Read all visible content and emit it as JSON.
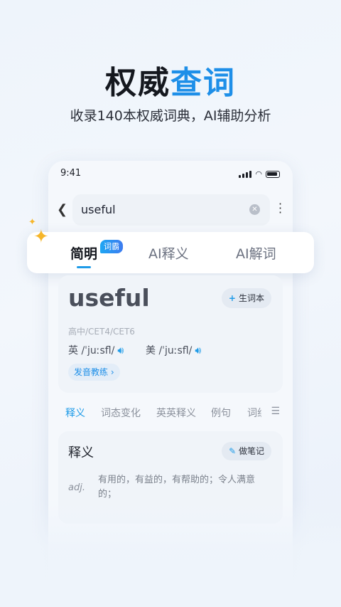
{
  "hero": {
    "title_part1": "权威",
    "title_part2": "查词",
    "subtitle": "收录140本权威词典，AI辅助分析"
  },
  "status_bar": {
    "time": "9:41"
  },
  "search": {
    "value": "useful"
  },
  "tabs": {
    "items": [
      {
        "label": "简明",
        "active": true
      },
      {
        "label": "AI释义",
        "active": false
      },
      {
        "label": "AI解词",
        "active": false
      }
    ],
    "badge": "词霸"
  },
  "word": {
    "text": "useful",
    "add_label": "生词本",
    "level": "高中/CET4/CET6",
    "uk": {
      "label": "英",
      "phonetic": "/ˈjuːsfl/"
    },
    "us": {
      "label": "美",
      "phonetic": "/ˈjuːsfl/"
    },
    "pron_button": "发音教练"
  },
  "subtabs": [
    "释义",
    "词态变化",
    "英英释义",
    "例句",
    "词组"
  ],
  "definition": {
    "title": "释义",
    "note_label": "做笔记",
    "pos": "adj.",
    "text": "有用的，有益的，有帮助的；令人满意的；"
  },
  "colors": {
    "accent": "#1e9be8",
    "sparkle": "#f6b62a"
  }
}
